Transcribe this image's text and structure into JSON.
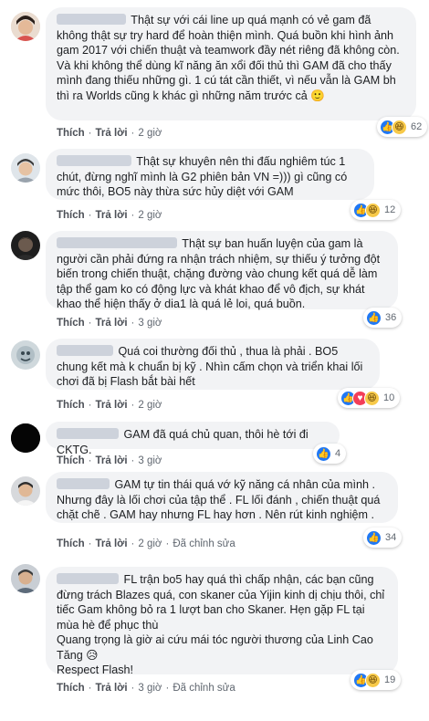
{
  "comments": [
    {
      "text": "Thật sự với cái line up quá mạnh có vẻ gam đã không thật sự try hard để hoàn thiện mình. Quá buồn khi hình ảnh gam 2017 với chiến thuật và teamwork đầy nét riêng đã không còn. Và khi không thể dùng kĩ năng ăn xổi đối thủ thì GAM đã cho thấy mình đang thiếu những gì. 1 cú tát cần thiết, vì nếu vẫn là GAM bh thì ra Worlds cũng k khác gì những năm trước cả 🙂",
      "like": "Thích",
      "reply": "Trả lời",
      "time": "2 giờ",
      "reactions": [
        "like",
        "haha"
      ],
      "count": "62"
    },
    {
      "text": "Thật sự khuyên nên thi đấu nghiêm túc 1 chút, đừng nghĩ mình là G2 phiên bản VN =))) gì cũng có mức thôi, BO5 này thừa sức hủy diệt với GAM",
      "like": "Thích",
      "reply": "Trả lời",
      "time": "2 giờ",
      "reactions": [
        "like",
        "haha"
      ],
      "count": "12"
    },
    {
      "text": "Thật sự ban huấn luyện của gam là người cần phải đứng ra nhận trách nhiệm, sự thiếu ý tưởng đột biến trong chiến thuật, chặng đường vào chung kết quá dễ làm tập thể gam ko có động lực và khát khao để vô địch, sự khát khao thể hiện thấy ở dia1 là quá lẻ loi, quá buồn.",
      "like": "Thích",
      "reply": "Trả lời",
      "time": "3 giờ",
      "reactions": [
        "like"
      ],
      "count": "36"
    },
    {
      "text": "Quá coi thường đối thủ , thua là phải . BO5 chung kết mà k chuẩn bị kỹ . Nhìn cấm chọn và triển khai lối chơi đã bị Flash bắt bài hết",
      "like": "Thích",
      "reply": "Trả lời",
      "time": "2 giờ",
      "reactions": [
        "like",
        "love",
        "haha"
      ],
      "count": "10"
    },
    {
      "text": "GAM đã quá chủ quan, thôi hè tới đi CKTG.",
      "like": "Thích",
      "reply": "Trả lời",
      "time": "3 giờ",
      "reactions": [
        "like"
      ],
      "count": "4"
    },
    {
      "text": "GAM tự tin thái quá vớ kỹ năng cá nhân của mình . Nhưng đây là lối chơi của tập thể . FL lối đánh , chiến thuật quá chặt chẽ . GAM hay nhưng FL hay hơn . Nên rút kinh nghiệm .",
      "like": "Thích",
      "reply": "Trả lời",
      "time": "2 giờ",
      "edited": "Đã chỉnh sửa",
      "reactions": [
        "like"
      ],
      "count": "34"
    },
    {
      "text": "FL trận bo5 hay quá thì chấp nhận, các bạn cũng đừng trách Blazes quá, con skaner của Yijin kinh dị chịu thôi, chỉ tiếc Gam không bỏ ra 1 lượt ban cho Skaner. Hẹn gặp FL tại mùa hè để phục thù\nQuang trọng là giờ ai cứu mái tóc người thương của Linh Cao Tăng 😥\nRespect Flash!",
      "like": "Thích",
      "reply": "Trả lời",
      "time": "3 giờ",
      "edited": "Đã chỉnh sửa",
      "reactions": [
        "like",
        "haha"
      ],
      "count": "19"
    }
  ],
  "colors": {
    "bubble": "#f2f3f5",
    "like": "#2078f4",
    "love": "#f33e58",
    "haha": "#f7c948"
  }
}
